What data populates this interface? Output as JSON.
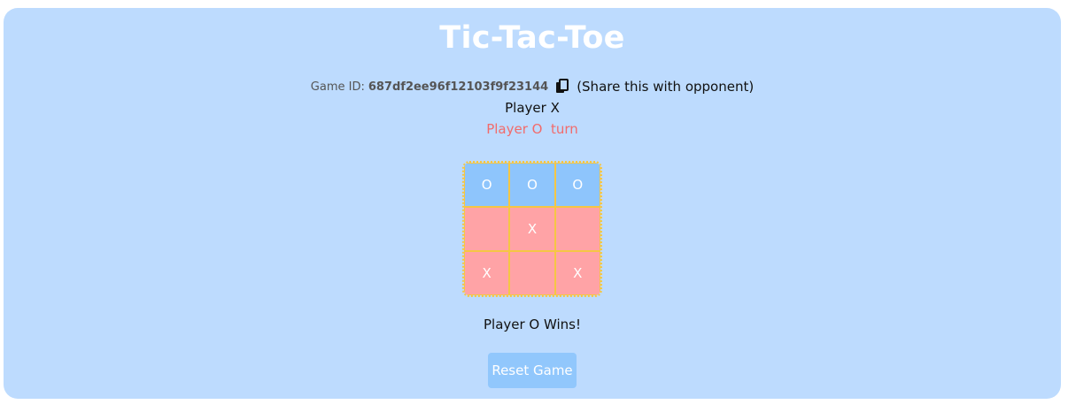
{
  "title": "Tic-Tac-Toe",
  "game": {
    "id_label": "Game ID:",
    "id_value": "687df2ee96f12103f9f23144",
    "copy_icon": "copy-icon",
    "share_note": "(Share this with opponent)"
  },
  "player_label": "Player X",
  "turn_label": "Player O  turn",
  "board": {
    "cells": [
      "O",
      "O",
      "O",
      "",
      "X",
      "",
      "X",
      "",
      "X"
    ]
  },
  "result": "Player O Wins!",
  "reset_label": "Reset Game",
  "colors": {
    "panel": "#bddbfe",
    "o_cell": "#8ec5fc",
    "x_cell": "#ffa3a6",
    "grid_line": "#f5c644",
    "turn_text": "#f26b6b",
    "button": "#91c7fc"
  }
}
